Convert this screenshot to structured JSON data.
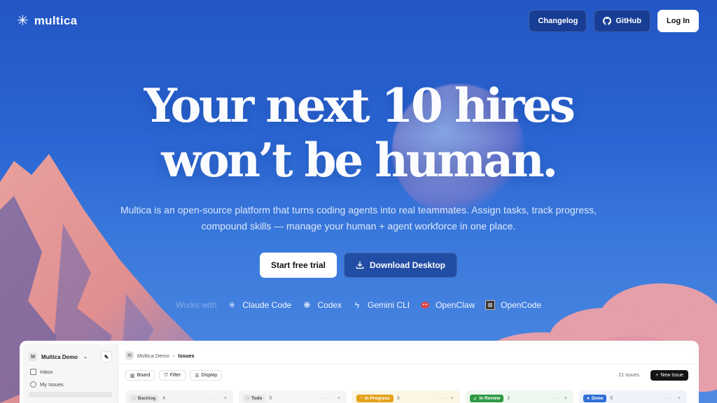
{
  "nav": {
    "brand": "multica",
    "brand_icon": "asterisk-logo-icon",
    "changelog": "Changelog",
    "github": "GitHub",
    "login": "Log In"
  },
  "hero": {
    "headline_line1": "Your next 10 hires",
    "headline_line2": "won’t be human.",
    "subtitle": "Multica is an open-source platform that turns coding agents into real teammates. Assign tasks, track progress, compound skills — manage your human + agent workforce in one place.",
    "cta_primary": "Start free trial",
    "cta_secondary": "Download Desktop",
    "works_with_label": "Works with",
    "agents": [
      {
        "name": "Claude Code",
        "icon": "claude-icon"
      },
      {
        "name": "Codex",
        "icon": "openai-icon"
      },
      {
        "name": "Gemini CLI",
        "icon": "gemini-icon"
      },
      {
        "name": "OpenClaw",
        "icon": "openclaw-icon"
      },
      {
        "name": "OpenCode",
        "icon": "opencode-icon"
      }
    ]
  },
  "app": {
    "workspace_initial": "M",
    "workspace_name": "Multica Demo",
    "sidebar": [
      {
        "label": "Inbox",
        "icon": "inbox-icon"
      },
      {
        "label": "My Issues",
        "icon": "user-circle-icon"
      }
    ],
    "breadcrumb": {
      "initial": "M",
      "workspace": "Multica Demo",
      "page": "Issues"
    },
    "toolbar": {
      "board": "Board",
      "filter": "Filter",
      "display": "Display"
    },
    "issue_count": "21 issues",
    "new_issue": "New Issue",
    "columns": [
      {
        "label": "Backlog",
        "count": "4"
      },
      {
        "label": "Todo",
        "count": "5"
      },
      {
        "label": "In Progress",
        "count": "3"
      },
      {
        "label": "In Review",
        "count": "2"
      },
      {
        "label": "Done",
        "count": "6"
      }
    ]
  },
  "colors": {
    "background_top": "#2256c4",
    "background_bottom": "#4f8ae2",
    "in_progress": "#e3a21a",
    "in_review": "#2f9a45",
    "done": "#2f6fd6"
  }
}
